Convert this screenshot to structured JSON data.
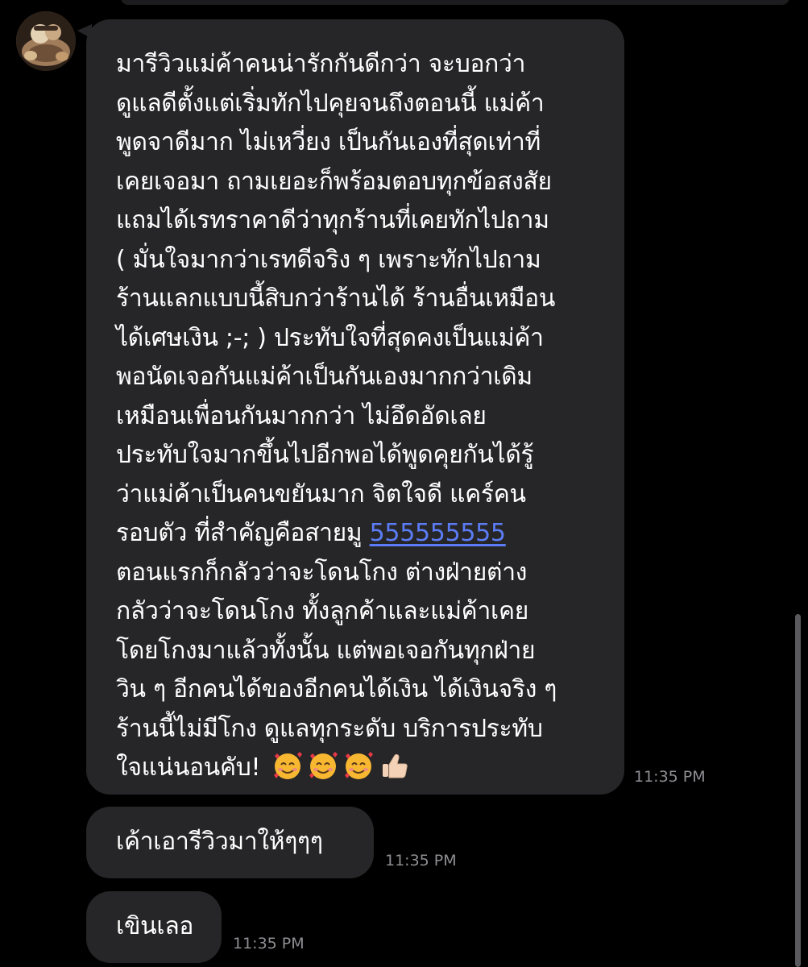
{
  "messages": [
    {
      "lines": [
        "มารีวิวแม่ค้าคนน่ารักกันดีกว่า จะบอกว่า",
        "ดูแลดีตั้งแต่เริ่มทักไปคุยจนถึงตอนนี้ แม่ค้า",
        "พูดจาดีมาก ไม่เหวี่ยง เป็นกันเองที่สุดเท่าที่",
        "เคยเจอมา ถามเยอะก็พร้อมตอบทุกข้อสงสัย",
        "แถมได้เรทราคาดีว่าทุกร้านที่เคยทักไปถาม",
        "( มั่นใจมากว่าเรทดีจริง ๆ เพราะทักไปถาม",
        "ร้านแลกแบบนี้สิบกว่าร้านได้ ร้านอื่นเหมือน",
        "ได้เศษเงิน ;-; ) ประทับใจที่สุดคงเป็นแม่ค้า",
        "พอนัดเจอกันแม่ค้าเป็นกันเองมากกว่าเดิม",
        "เหมือนเพื่อนกันมากกว่า ไม่อึดอัดเลย",
        "ประทับใจมากขึ้นไปอีกพอได้พูดคุยกันได้รู้",
        "ว่าแม่ค้าเป็นคนขยันมาก จิตใจดี  แคร์คน"
      ],
      "line_13_prefix": "รอบตัว ที่สำคัญคือสายมู ",
      "link_text": "555555555",
      "lines_after": [
        "ตอนแรกก็กลัวว่าจะโดนโกง ต่างฝ่ายต่าง",
        "กลัวว่าจะโดนโกง ทั้งลูกค้าและแม่ค้าเคย",
        "โดยโกงมาแล้วทั้งนั้น แต่พอเจอกันทุกฝ่าย",
        "วิน ๆ อีกคนได้ของอีกคนได้เงิน ได้เงินจริง ๆ",
        "ร้านนี้ไม่มีโกง ดูแลทุกระดับ บริการประทับ"
      ],
      "last_line": "ใจแน่นอนคับ!",
      "emoji_icons": [
        "smiling-face-with-hearts-icon",
        "smiling-face-with-hearts-icon",
        "smiling-face-with-hearts-icon",
        "thumbs-up-icon"
      ],
      "time": "11:35 PM"
    },
    {
      "text": "เค้าเอารีวิวมาให้ๆๆๆ",
      "time": "11:35 PM"
    },
    {
      "text": "เขินเลอ",
      "time": "11:35 PM"
    }
  ],
  "colors": {
    "background": "#000000",
    "bubble": "#262628",
    "text": "#ffffff",
    "link": "#5b7cf5",
    "timestamp": "#8e8e93"
  }
}
